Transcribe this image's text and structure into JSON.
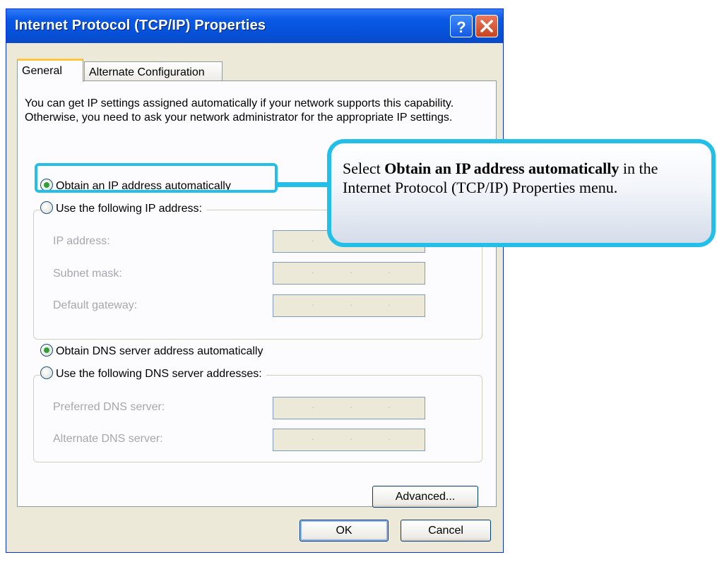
{
  "window": {
    "title": "Internet Protocol (TCP/IP) Properties",
    "help_icon": "help-icon",
    "close_icon": "close-icon"
  },
  "tabs": [
    {
      "label": "General",
      "selected": true
    },
    {
      "label": "Alternate Configuration",
      "selected": false
    }
  ],
  "description": "You can get IP settings assigned automatically if your network supports this capability. Otherwise, you need to ask your network administrator for the appropriate IP settings.",
  "ip_section": {
    "auto_label": "Obtain an IP address automatically",
    "auto_selected": true,
    "manual_label": "Use the following IP address:",
    "fields": [
      {
        "label": "IP address:",
        "value": ""
      },
      {
        "label": "Subnet mask:",
        "value": ""
      },
      {
        "label": "Default gateway:",
        "value": ""
      }
    ]
  },
  "dns_section": {
    "auto_label": "Obtain DNS server address automatically",
    "auto_selected": true,
    "manual_label": "Use the following DNS server addresses:",
    "fields": [
      {
        "label": "Preferred DNS server:",
        "value": ""
      },
      {
        "label": "Alternate DNS server:",
        "value": ""
      }
    ]
  },
  "buttons": {
    "advanced": "Advanced...",
    "ok": "OK",
    "cancel": "Cancel"
  },
  "callout": {
    "prefix": "Select ",
    "bold": "Obtain an IP address automatically",
    "suffix": " in the Internet Protocol (TCP/IP) Properties menu."
  },
  "colors": {
    "highlight": "#23bfe8",
    "titlebar": "#0551d8",
    "dialog_bg": "#ece9d8"
  }
}
